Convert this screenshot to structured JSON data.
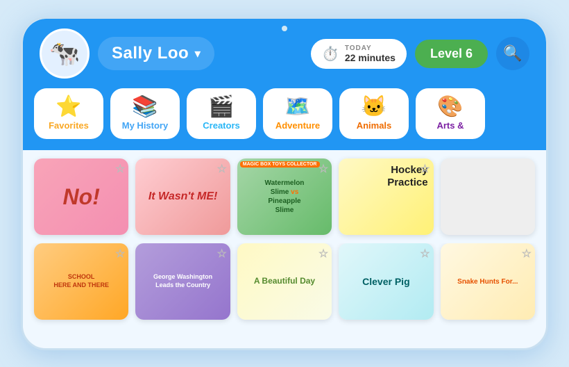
{
  "header": {
    "user_name": "Sally Loo",
    "dropdown_arrow": "▾",
    "timer_label": "TODAY",
    "timer_value": "22 minutes",
    "level_label": "Level 6",
    "search_icon": "🔍",
    "avatar_emoji": "🐮"
  },
  "categories": [
    {
      "id": "favorites",
      "label": "Favorites",
      "icon": "⭐",
      "color": "#f9a825"
    },
    {
      "id": "history",
      "label": "My History",
      "icon": "📚",
      "color": "#42a5f5"
    },
    {
      "id": "creators",
      "label": "Creators",
      "icon": "🎬",
      "color": "#29b6f6"
    },
    {
      "id": "adventure",
      "label": "Adventure",
      "icon": "🗺️",
      "color": "#ff8f00"
    },
    {
      "id": "animals",
      "label": "Animals",
      "icon": "🐱",
      "color": "#ef6c00"
    },
    {
      "id": "arts",
      "label": "Arts &",
      "icon": "🎨",
      "color": "#7b1fa2"
    }
  ],
  "books_row1": [
    {
      "id": "no",
      "title": "No!",
      "style": "book-no"
    },
    {
      "id": "wasnt",
      "title": "It Wasn't ME!",
      "style": "book-wasnt"
    },
    {
      "id": "watermelon",
      "title": "Watermelon Slime vs Pineapple Slime",
      "style": "book-watermelon",
      "top_label": "MAGIC BOX TOYS COLLECTOR"
    },
    {
      "id": "hockey",
      "title": "Hockey Practice",
      "style": "book-hockey"
    },
    {
      "id": "placeholder1",
      "title": "",
      "style": "book-hockey"
    }
  ],
  "books_row2": [
    {
      "id": "school",
      "title": "SCHOOL HERE AND THERE",
      "style": "book-school"
    },
    {
      "id": "george",
      "title": "George Washington Leads the Country",
      "style": "book-george"
    },
    {
      "id": "beautiful",
      "title": "A Beautiful Day",
      "style": "book-beautiful"
    },
    {
      "id": "clever",
      "title": "Clever Pig",
      "style": "book-clever"
    },
    {
      "id": "snake",
      "title": "Snake Hunts For...",
      "style": "book-snake"
    }
  ]
}
